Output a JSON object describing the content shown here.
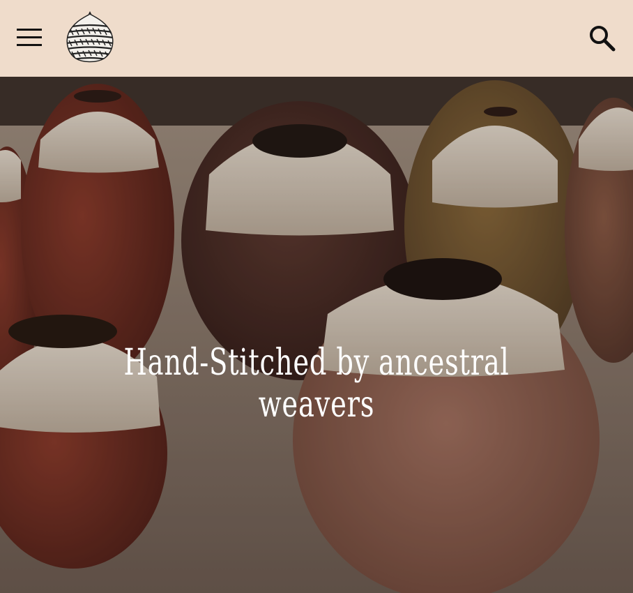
{
  "header": {
    "menu_icon": "hamburger-menu-icon",
    "logo_icon": "woven-basket-logo",
    "search_icon": "search-icon",
    "background": "#efdccb"
  },
  "hero": {
    "title": "Hand-Stitched by ancestral weavers",
    "image_subject": "woven-pottery-vessels-photo"
  }
}
